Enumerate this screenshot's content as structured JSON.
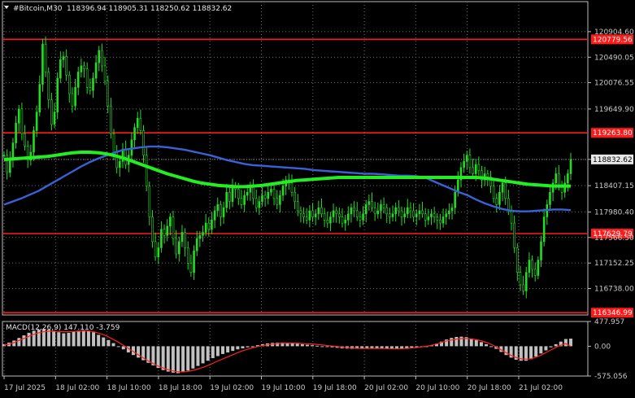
{
  "header": {
    "symbol": "#Bitcoin,M30",
    "ohlc": "118396.94 118905.31 118250.62 118832.62"
  },
  "colors": {
    "background": "#000000",
    "candle": "#22dd22",
    "ma_fast": "#3a62d8",
    "ma_slow": "#22ee22",
    "ma_mid": "#2a8f8a",
    "level": "#ff1a1a",
    "macd_hist": "#c0c0c0",
    "macd_signal": "#ff2020",
    "grid": "#6f6f6f"
  },
  "chart_data": [
    {
      "type": "candlestick",
      "title": "#Bitcoin,M30",
      "y_ticks": [
        "120904.60",
        "120490.05",
        "120076.55",
        "119649.90",
        "118832.62",
        "118407.15",
        "117980.40",
        "117566.50",
        "117152.25",
        "116738.00"
      ],
      "ylim": [
        116310,
        121180
      ],
      "x_ticks": [
        "17 Jul 2025",
        "18 Jul 02:00",
        "18 Jul 10:00",
        "18 Jul 18:00",
        "19 Jul 02:00",
        "19 Jul 10:00",
        "19 Jul 18:00",
        "20 Jul 02:00",
        "20 Jul 10:00",
        "20 Jul 18:00",
        "21 Jul 02:00"
      ],
      "last_price": "118832.62",
      "levels": [
        {
          "value": 120779.56,
          "label": "120779.56"
        },
        {
          "value": 119263.8,
          "label": "119263.80"
        },
        {
          "value": 117629.79,
          "label": "117629.79"
        },
        {
          "value": 116346.99,
          "label": "116346.99"
        }
      ],
      "close_series": [
        118900,
        118620,
        118830,
        119100,
        119420,
        119650,
        119250,
        119050,
        118820,
        118950,
        119300,
        119600,
        120050,
        120700,
        120250,
        119800,
        119400,
        119600,
        120150,
        120450,
        120500,
        120200,
        119900,
        119700,
        120000,
        120250,
        120350,
        120300,
        120000,
        119950,
        120150,
        120400,
        120600,
        120350,
        120100,
        119700,
        119250,
        118950,
        118700,
        118800,
        119000,
        118750,
        118900,
        119150,
        119350,
        119500,
        119300,
        118900,
        118400,
        117900,
        117500,
        117250,
        117400,
        117700,
        117600,
        117750,
        117900,
        117550,
        117300,
        117500,
        117650,
        117400,
        117150,
        117000,
        117350,
        117550,
        117600,
        117650,
        117800,
        117700,
        117850,
        118000,
        118100,
        117900,
        118050,
        118300,
        118150,
        118400,
        118350,
        118200,
        118100,
        118250,
        118300,
        118400,
        118200,
        118050,
        118150,
        118250,
        118200,
        118300,
        118350,
        118200,
        118100,
        118250,
        118400,
        118500,
        118450,
        118300,
        118150,
        118000,
        117950,
        117900,
        117850,
        118000,
        117900,
        117950,
        118050,
        117950,
        117850,
        117800,
        117900,
        118000,
        117950,
        117900,
        117800,
        117850,
        117950,
        118050,
        118000,
        117900,
        117850,
        117950,
        118100,
        118150,
        118050,
        117950,
        118000,
        118100,
        118050,
        117950,
        117900,
        117950,
        118050,
        118000,
        117900,
        117950,
        118050,
        118000,
        117900,
        117950,
        118000,
        117950,
        117850,
        117900,
        117950,
        117900,
        117850,
        117800,
        117900,
        117950,
        118000,
        118050,
        118300,
        118500,
        118700,
        118800,
        118900,
        118700,
        118600,
        118750,
        118650,
        118500,
        118600,
        118550,
        118400,
        118200,
        118100,
        118300,
        118450,
        118200,
        118000,
        117800,
        117400,
        117000,
        116800,
        116700,
        117000,
        117200,
        117050,
        116950,
        117200,
        117500,
        117900,
        118100,
        118300,
        118450,
        118600,
        118400,
        118300,
        118450,
        118600,
        118832
      ],
      "ma_fast": [
        118100,
        118150,
        118200,
        118260,
        118320,
        118400,
        118480,
        118560,
        118640,
        118720,
        118790,
        118850,
        118900,
        118950,
        118990,
        119010,
        119030,
        119040,
        119040,
        119030,
        119010,
        118990,
        118960,
        118930,
        118900,
        118860,
        118820,
        118790,
        118760,
        118740,
        118730,
        118720,
        118710,
        118700,
        118690,
        118680,
        118660,
        118650,
        118640,
        118630,
        118620,
        118610,
        118600,
        118600,
        118590,
        118580,
        118570,
        118570,
        118560,
        118540,
        118480,
        118420,
        118360,
        118300,
        118250,
        118180,
        118120,
        118070,
        118030,
        118000,
        117990,
        117990,
        118000,
        118010,
        118020,
        118020,
        118010
      ],
      "ma_slow": [
        118830,
        118840,
        118850,
        118860,
        118870,
        118880,
        118900,
        118920,
        118940,
        118950,
        118950,
        118940,
        118920,
        118890,
        118850,
        118800,
        118750,
        118700,
        118650,
        118600,
        118560,
        118520,
        118480,
        118450,
        118430,
        118410,
        118400,
        118390,
        118390,
        118400,
        118410,
        118430,
        118450,
        118470,
        118490,
        118500,
        118510,
        118520,
        118530,
        118540,
        118540,
        118540,
        118540,
        118540,
        118540,
        118540,
        118540,
        118540,
        118540,
        118540,
        118540,
        118540,
        118540,
        118540,
        118540,
        118540,
        118530,
        118510,
        118490,
        118470,
        118450,
        118430,
        118420,
        118410,
        118400,
        118400,
        118400
      ]
    },
    {
      "type": "bar",
      "title": "MACD(12,26,9) 147.110 -3.759",
      "y_ticks": [
        "477.957",
        "0.00",
        "-575.056"
      ],
      "ylim": [
        -575.056,
        477.957
      ],
      "histogram": [
        40,
        70,
        110,
        160,
        210,
        260,
        300,
        320,
        330,
        320,
        300,
        270,
        250,
        260,
        280,
        300,
        310,
        300,
        270,
        220,
        170,
        120,
        60,
        0,
        -60,
        -120,
        -170,
        -220,
        -270,
        -320,
        -370,
        -420,
        -460,
        -490,
        -510,
        -520,
        -500,
        -470,
        -430,
        -380,
        -330,
        -280,
        -230,
        -190,
        -150,
        -120,
        -90,
        -60,
        -40,
        -20,
        0,
        20,
        40,
        55,
        65,
        70,
        72,
        70,
        60,
        50,
        40,
        30,
        20,
        10,
        0,
        -10,
        -20,
        -30,
        -40,
        -45,
        -50,
        -50,
        -50,
        -45,
        -40,
        -40,
        -45,
        -50,
        -55,
        -55,
        -50,
        -40,
        -30,
        -20,
        -10,
        0,
        20,
        50,
        90,
        130,
        160,
        180,
        185,
        175,
        150,
        120,
        80,
        40,
        0,
        -50,
        -110,
        -170,
        -220,
        -260,
        -280,
        -280,
        -250,
        -200,
        -140,
        -80,
        -20,
        40,
        90,
        140,
        147
      ],
      "signal": [
        20,
        40,
        70,
        110,
        150,
        190,
        230,
        260,
        280,
        290,
        290,
        285,
        280,
        280,
        285,
        290,
        295,
        295,
        285,
        260,
        230,
        190,
        140,
        90,
        30,
        -30,
        -90,
        -150,
        -210,
        -270,
        -320,
        -370,
        -410,
        -445,
        -470,
        -490,
        -495,
        -490,
        -475,
        -450,
        -420,
        -385,
        -345,
        -300,
        -260,
        -220,
        -180,
        -140,
        -100,
        -70,
        -40,
        -15,
        5,
        20,
        35,
        45,
        55,
        60,
        62,
        60,
        55,
        50,
        45,
        40,
        30,
        20,
        10,
        0,
        -10,
        -20,
        -30,
        -35,
        -40,
        -42,
        -42,
        -42,
        -43,
        -44,
        -46,
        -48,
        -48,
        -46,
        -40,
        -32,
        -22,
        -10,
        5,
        25,
        50,
        80,
        105,
        125,
        140,
        148,
        148,
        140,
        125,
        100,
        70,
        30,
        -20,
        -75,
        -130,
        -180,
        -220,
        -245,
        -250,
        -240,
        -210,
        -170,
        -120,
        -70,
        -20,
        20,
        50,
        -4
      ]
    }
  ]
}
